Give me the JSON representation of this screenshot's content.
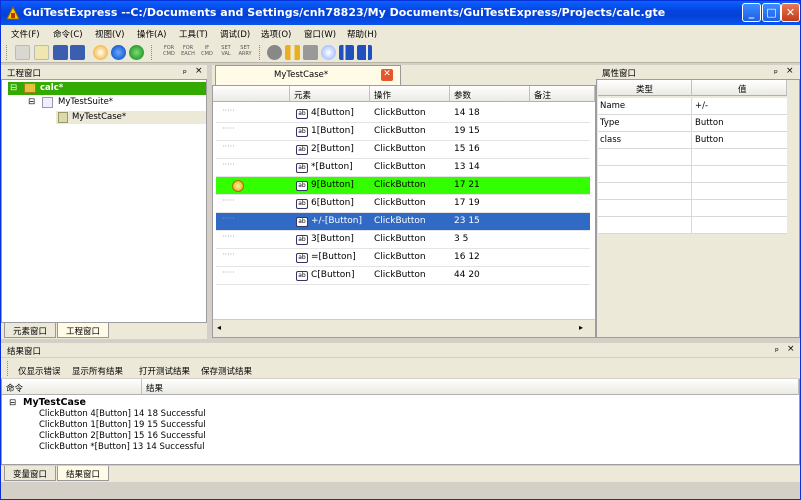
{
  "window": {
    "title": "GuiTestExpress --C:/Documents and Settings/cnh78823/My Documents/GuiTestExpress/Projects/calc.gte",
    "minimize": "_",
    "maximize": "□",
    "close": "✕"
  },
  "menu": [
    "文件(F)",
    "命令(C)",
    "视图(V)",
    "操作(A)",
    "工具(T)",
    "调试(D)",
    "选项(O)",
    "窗口(W)",
    "帮助(H)"
  ],
  "toolbar": {
    "for_cmd": [
      "FOR",
      "CMD"
    ],
    "for_each": [
      "FOR",
      "EACH"
    ],
    "if_cmd": [
      "IF",
      "CMD"
    ],
    "set_val": [
      "SET",
      "VAL"
    ],
    "set_arry": [
      "SET",
      "ARRY"
    ]
  },
  "project_panel": {
    "title": "工程窗口",
    "pin": "ₚ",
    "close": "×",
    "tree": {
      "root": "calc*",
      "suite": "MyTestSuite*",
      "case": "MyTestCase*"
    },
    "tabs": [
      "元素窗口",
      "工程窗口"
    ]
  },
  "editor": {
    "tab_title": "MyTestCase*",
    "columns": [
      "元素",
      "操作",
      "参数",
      "备注"
    ],
    "rows": [
      {
        "element": "4[Button]",
        "action": "ClickButton",
        "params": "14 18"
      },
      {
        "element": "1[Button]",
        "action": "ClickButton",
        "params": "19 15"
      },
      {
        "element": "2[Button]",
        "action": "ClickButton",
        "params": "15 16"
      },
      {
        "element": "*[Button]",
        "action": "ClickButton",
        "params": "13 14"
      },
      {
        "element": "9[Button]",
        "action": "ClickButton",
        "params": "17 21"
      },
      {
        "element": "6[Button]",
        "action": "ClickButton",
        "params": "17 19"
      },
      {
        "element": "+/-[Button]",
        "action": "ClickButton",
        "params": "23 15"
      },
      {
        "element": "3[Button]",
        "action": "ClickButton",
        "params": "3 5"
      },
      {
        "element": "=[Button]",
        "action": "ClickButton",
        "params": "16 12"
      },
      {
        "element": "C[Button]",
        "action": "ClickButton",
        "params": "44 20"
      }
    ],
    "icon_text": "ab"
  },
  "property_panel": {
    "title": "属性窗口",
    "columns": [
      "类型",
      "值"
    ],
    "rows": [
      {
        "key": "Name",
        "value": "+/-"
      },
      {
        "key": "Type",
        "value": "Button"
      },
      {
        "key": "class",
        "value": "Button"
      }
    ]
  },
  "result_panel": {
    "title": "结果窗口",
    "buttons": [
      "仅显示错误",
      "显示所有结果",
      "打开测试结果",
      "保存测试结果"
    ],
    "columns": [
      "命令",
      "结果"
    ],
    "group": "MyTestCase",
    "lines": [
      "ClickButton 4[Button] 14 18  Successful",
      "ClickButton 1[Button] 19 15  Successful",
      "ClickButton 2[Button] 15 16  Successful",
      "ClickButton *[Button] 13 14  Successful"
    ],
    "tabs": [
      "变量窗口",
      "结果窗口"
    ]
  },
  "colors": {
    "highlight_green": "#33ff00",
    "selected_blue": "#316ac5",
    "titlebar": "#0545e0"
  }
}
